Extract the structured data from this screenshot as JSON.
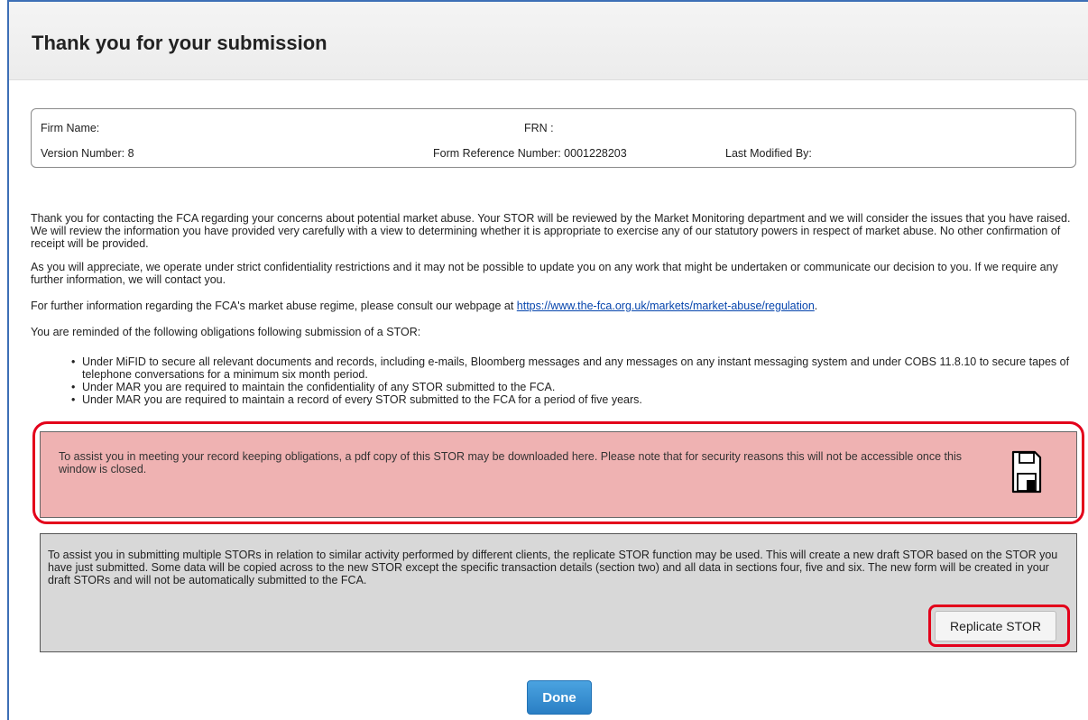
{
  "page_title": "Thank you for your submission",
  "info": {
    "firm_name_label": "Firm Name:",
    "frn_label": "FRN :",
    "version_number": "Version Number: 8",
    "form_reference": "Form Reference Number: 0001228203",
    "last_modified_by": "Last Modified By:"
  },
  "paragraphs": {
    "p1": "Thank you for contacting the FCA regarding your concerns about potential market abuse. Your STOR will be reviewed by the Market Monitoring department and we will consider the issues that you have raised. We will review the information you have provided very carefully with a view to determining whether it is appropriate to exercise any of our statutory powers in respect of market abuse. No other confirmation of receipt will be provided.",
    "p2": "As you will appreciate, we operate under strict confidentiality restrictions and it may not be possible to update you on any work that might be undertaken or communicate our decision to you. If we require any further information, we will contact you.",
    "p3_prefix": "For further information regarding the FCA's market abuse regime, please consult our webpage at ",
    "p3_link": "https://www.the-fca.org.uk/markets/market-abuse/regulation",
    "p3_suffix": ".",
    "p4": "You are reminded of the following obligations following submission of a STOR:"
  },
  "obligations": [
    "Under MiFID to secure all relevant documents and records, including e-mails, Bloomberg messages and any messages on any instant messaging system and under COBS 11.8.10 to secure tapes of telephone conversations for a minimum six month period.",
    "Under MAR you are required to maintain the confidentiality of any STOR submitted to the FCA.",
    "Under MAR you are required to maintain a record of every STOR submitted to the FCA for a period of five years."
  ],
  "pdf_box": {
    "text": "To assist you in meeting your record keeping obligations, a pdf copy of this STOR may be downloaded here. Please note that for security reasons this will not be accessible once this window is closed.",
    "icon": "save-icon",
    "background": "#efb2b2"
  },
  "replicate_box": {
    "text": "To assist you in submitting multiple STORs in relation to similar activity performed by different clients, the replicate STOR function may be used. This will create a new draft STOR based on the STOR you have just submitted. Some data will be copied across to the new STOR except the specific transaction details (section two) and all data in sections four, five and six. The new form will be created in your draft STORs and will not be automatically submitted to the FCA.",
    "button_label": "Replicate STOR",
    "background": "#d8d8d8"
  },
  "done_label": "Done",
  "colors": {
    "highlight_outline": "#e3001b",
    "link": "#0645ad",
    "primary_button": "#2a7fc4"
  }
}
